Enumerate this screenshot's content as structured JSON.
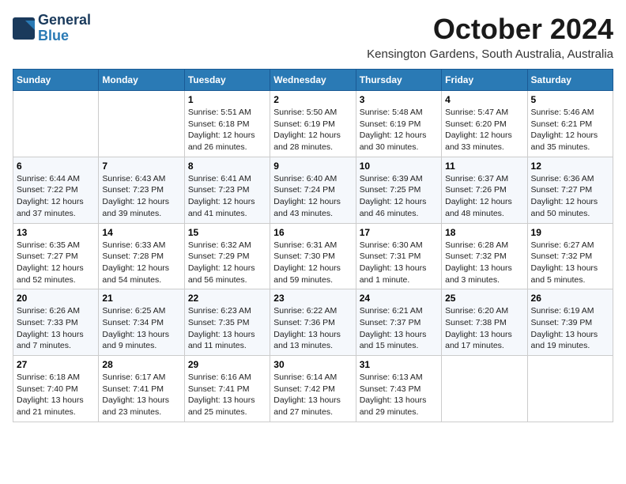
{
  "header": {
    "logo_line1": "General",
    "logo_line2": "Blue",
    "month_title": "October 2024",
    "location": "Kensington Gardens, South Australia, Australia"
  },
  "weekdays": [
    "Sunday",
    "Monday",
    "Tuesday",
    "Wednesday",
    "Thursday",
    "Friday",
    "Saturday"
  ],
  "weeks": [
    [
      {
        "day": "",
        "info": ""
      },
      {
        "day": "",
        "info": ""
      },
      {
        "day": "1",
        "info": "Sunrise: 5:51 AM\nSunset: 6:18 PM\nDaylight: 12 hours and 26 minutes."
      },
      {
        "day": "2",
        "info": "Sunrise: 5:50 AM\nSunset: 6:19 PM\nDaylight: 12 hours and 28 minutes."
      },
      {
        "day": "3",
        "info": "Sunrise: 5:48 AM\nSunset: 6:19 PM\nDaylight: 12 hours and 30 minutes."
      },
      {
        "day": "4",
        "info": "Sunrise: 5:47 AM\nSunset: 6:20 PM\nDaylight: 12 hours and 33 minutes."
      },
      {
        "day": "5",
        "info": "Sunrise: 5:46 AM\nSunset: 6:21 PM\nDaylight: 12 hours and 35 minutes."
      }
    ],
    [
      {
        "day": "6",
        "info": "Sunrise: 6:44 AM\nSunset: 7:22 PM\nDaylight: 12 hours and 37 minutes."
      },
      {
        "day": "7",
        "info": "Sunrise: 6:43 AM\nSunset: 7:23 PM\nDaylight: 12 hours and 39 minutes."
      },
      {
        "day": "8",
        "info": "Sunrise: 6:41 AM\nSunset: 7:23 PM\nDaylight: 12 hours and 41 minutes."
      },
      {
        "day": "9",
        "info": "Sunrise: 6:40 AM\nSunset: 7:24 PM\nDaylight: 12 hours and 43 minutes."
      },
      {
        "day": "10",
        "info": "Sunrise: 6:39 AM\nSunset: 7:25 PM\nDaylight: 12 hours and 46 minutes."
      },
      {
        "day": "11",
        "info": "Sunrise: 6:37 AM\nSunset: 7:26 PM\nDaylight: 12 hours and 48 minutes."
      },
      {
        "day": "12",
        "info": "Sunrise: 6:36 AM\nSunset: 7:27 PM\nDaylight: 12 hours and 50 minutes."
      }
    ],
    [
      {
        "day": "13",
        "info": "Sunrise: 6:35 AM\nSunset: 7:27 PM\nDaylight: 12 hours and 52 minutes."
      },
      {
        "day": "14",
        "info": "Sunrise: 6:33 AM\nSunset: 7:28 PM\nDaylight: 12 hours and 54 minutes."
      },
      {
        "day": "15",
        "info": "Sunrise: 6:32 AM\nSunset: 7:29 PM\nDaylight: 12 hours and 56 minutes."
      },
      {
        "day": "16",
        "info": "Sunrise: 6:31 AM\nSunset: 7:30 PM\nDaylight: 12 hours and 59 minutes."
      },
      {
        "day": "17",
        "info": "Sunrise: 6:30 AM\nSunset: 7:31 PM\nDaylight: 13 hours and 1 minute."
      },
      {
        "day": "18",
        "info": "Sunrise: 6:28 AM\nSunset: 7:32 PM\nDaylight: 13 hours and 3 minutes."
      },
      {
        "day": "19",
        "info": "Sunrise: 6:27 AM\nSunset: 7:32 PM\nDaylight: 13 hours and 5 minutes."
      }
    ],
    [
      {
        "day": "20",
        "info": "Sunrise: 6:26 AM\nSunset: 7:33 PM\nDaylight: 13 hours and 7 minutes."
      },
      {
        "day": "21",
        "info": "Sunrise: 6:25 AM\nSunset: 7:34 PM\nDaylight: 13 hours and 9 minutes."
      },
      {
        "day": "22",
        "info": "Sunrise: 6:23 AM\nSunset: 7:35 PM\nDaylight: 13 hours and 11 minutes."
      },
      {
        "day": "23",
        "info": "Sunrise: 6:22 AM\nSunset: 7:36 PM\nDaylight: 13 hours and 13 minutes."
      },
      {
        "day": "24",
        "info": "Sunrise: 6:21 AM\nSunset: 7:37 PM\nDaylight: 13 hours and 15 minutes."
      },
      {
        "day": "25",
        "info": "Sunrise: 6:20 AM\nSunset: 7:38 PM\nDaylight: 13 hours and 17 minutes."
      },
      {
        "day": "26",
        "info": "Sunrise: 6:19 AM\nSunset: 7:39 PM\nDaylight: 13 hours and 19 minutes."
      }
    ],
    [
      {
        "day": "27",
        "info": "Sunrise: 6:18 AM\nSunset: 7:40 PM\nDaylight: 13 hours and 21 minutes."
      },
      {
        "day": "28",
        "info": "Sunrise: 6:17 AM\nSunset: 7:41 PM\nDaylight: 13 hours and 23 minutes."
      },
      {
        "day": "29",
        "info": "Sunrise: 6:16 AM\nSunset: 7:41 PM\nDaylight: 13 hours and 25 minutes."
      },
      {
        "day": "30",
        "info": "Sunrise: 6:14 AM\nSunset: 7:42 PM\nDaylight: 13 hours and 27 minutes."
      },
      {
        "day": "31",
        "info": "Sunrise: 6:13 AM\nSunset: 7:43 PM\nDaylight: 13 hours and 29 minutes."
      },
      {
        "day": "",
        "info": ""
      },
      {
        "day": "",
        "info": ""
      }
    ]
  ]
}
